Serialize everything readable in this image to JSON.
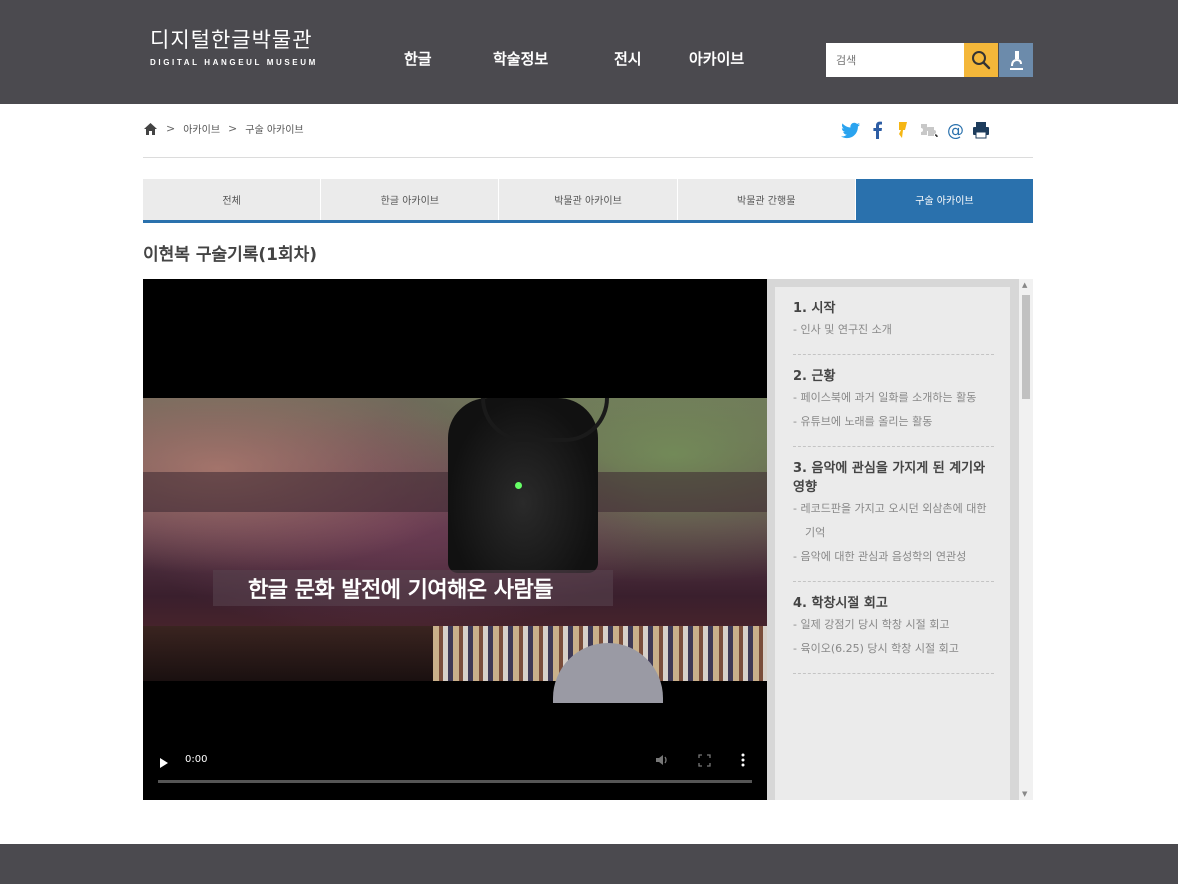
{
  "header": {
    "logo_ko": "디지털한글박물관",
    "logo_en": "DIGITAL HANGEUL MUSEUM",
    "nav": [
      "한글",
      "학술정보",
      "전시",
      "아카이브"
    ],
    "search_placeholder": "검색",
    "search_icon": "magnifier-icon",
    "micro_icon": "microscope-icon"
  },
  "breadcrumb": {
    "items": [
      "아카이브",
      "구술 아카이브"
    ]
  },
  "share_icons": [
    "twitter-icon",
    "facebook-icon",
    "kakaostory-icon",
    "blog-icon",
    "email-icon",
    "print-icon"
  ],
  "tabs": {
    "items": [
      "전체",
      "한글 아카이브",
      "박물관 아카이브",
      "박물관 간행물",
      "구술 아카이브"
    ],
    "active_index": 4
  },
  "page": {
    "title": "이현복 구술기록(1회차)"
  },
  "video": {
    "caption": "한글 문화 발전에 기여해온 사람들",
    "time": "0:00",
    "progress_fraction": 0
  },
  "chapters": [
    {
      "title": "1. 시작",
      "items": [
        "- 인사 및 연구진 소개"
      ]
    },
    {
      "title": "2. 근황",
      "items": [
        "- 페이스북에 과거 일화를 소개하는 활동",
        "- 유튜브에 노래를 올리는 활동"
      ]
    },
    {
      "title": "3. 음악에 관심을 가지게 된 계기와 영향",
      "items": [
        "- 레코드판을 가지고 오시던 외삼촌에 대한 기억",
        "- 음악에 대한 관심과 음성학의 연관성"
      ]
    },
    {
      "title": "4. 학창시절 회고",
      "items": [
        "- 일제 강점기 당시 학창 시절 회고",
        "- 육이오(6.25) 당시 학창 시절 회고"
      ]
    }
  ],
  "colors": {
    "header_bg": "#4b4a4f",
    "accent_blue": "#2a71ad",
    "search_yellow": "#f4b73a"
  }
}
